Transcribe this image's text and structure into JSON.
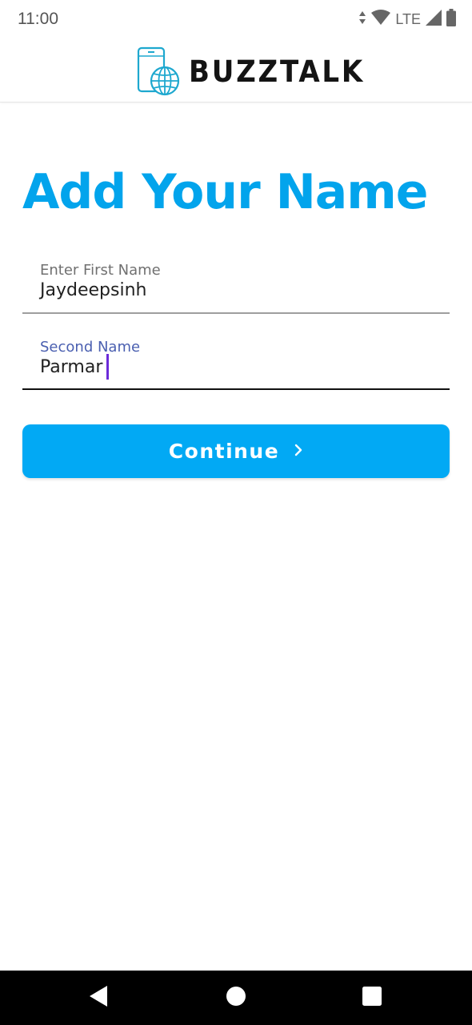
{
  "status_bar": {
    "time": "11:00",
    "network": "LTE",
    "icons": [
      "data-arrows-icon",
      "wifi-icon",
      "signal-icon",
      "battery-icon"
    ]
  },
  "header": {
    "brand_name": "BUZZTALK",
    "logo_icon": "phone-globe-icon",
    "accent_color": "#02a4ec"
  },
  "main": {
    "title": "Add Your Name",
    "fields": [
      {
        "label": "Enter First Name",
        "value": "Jaydeepsinh",
        "focused": false
      },
      {
        "label": "Second Name",
        "value": "Parmar",
        "focused": true
      }
    ],
    "continue_button": {
      "label": "Continue",
      "icon": "chevron-right-icon",
      "color": "#02a9f4"
    }
  },
  "nav_bar": {
    "icons": [
      "back-icon",
      "home-icon",
      "recents-icon"
    ]
  }
}
